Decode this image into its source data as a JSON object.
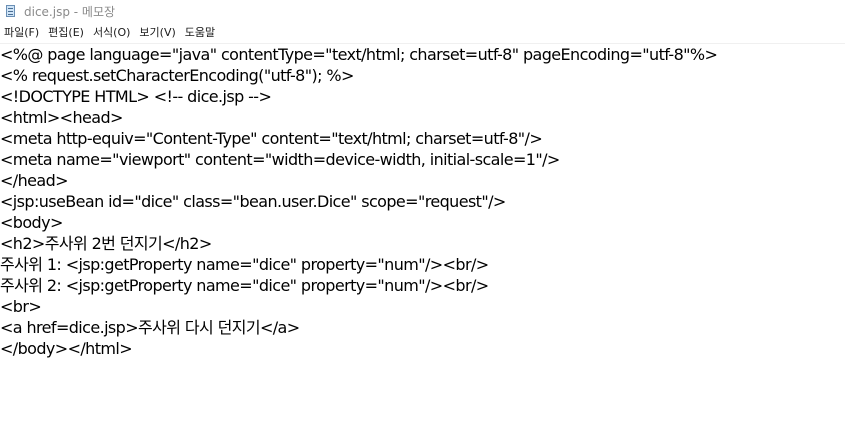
{
  "window": {
    "title": "dice.jsp - 메모장"
  },
  "menu": {
    "items": [
      {
        "id": "file",
        "label": "파일(F)"
      },
      {
        "id": "edit",
        "label": "편집(E)"
      },
      {
        "id": "format",
        "label": "서식(O)"
      },
      {
        "id": "view",
        "label": "보기(V)"
      },
      {
        "id": "help",
        "label": "도움말"
      }
    ]
  },
  "editor": {
    "lines": [
      "<%@ page language=\"java\" contentType=\"text/html; charset=utf-8\" pageEncoding=\"utf-8\"%>",
      "<% request.setCharacterEncoding(\"utf-8\"); %>",
      "<!DOCTYPE HTML> <!-- dice.jsp -->",
      "<html><head>",
      "<meta http-equiv=\"Content-Type\" content=\"text/html; charset=utf-8\"/>",
      "<meta name=\"viewport\" content=\"width=device-width, initial-scale=1\"/>",
      "</head>",
      "<jsp:useBean id=\"dice\" class=\"bean.user.Dice\" scope=\"request\"/>",
      "<body>",
      "<h2>주사위 2번 던지기</h2>",
      "주사위 1: <jsp:getProperty name=\"dice\" property=\"num\"/><br/>",
      "주사위 2: <jsp:getProperty name=\"dice\" property=\"num\"/><br/>",
      "<br>",
      "<a href=dice.jsp>주사위 다시 던지기</a>",
      "</body></html>"
    ]
  }
}
